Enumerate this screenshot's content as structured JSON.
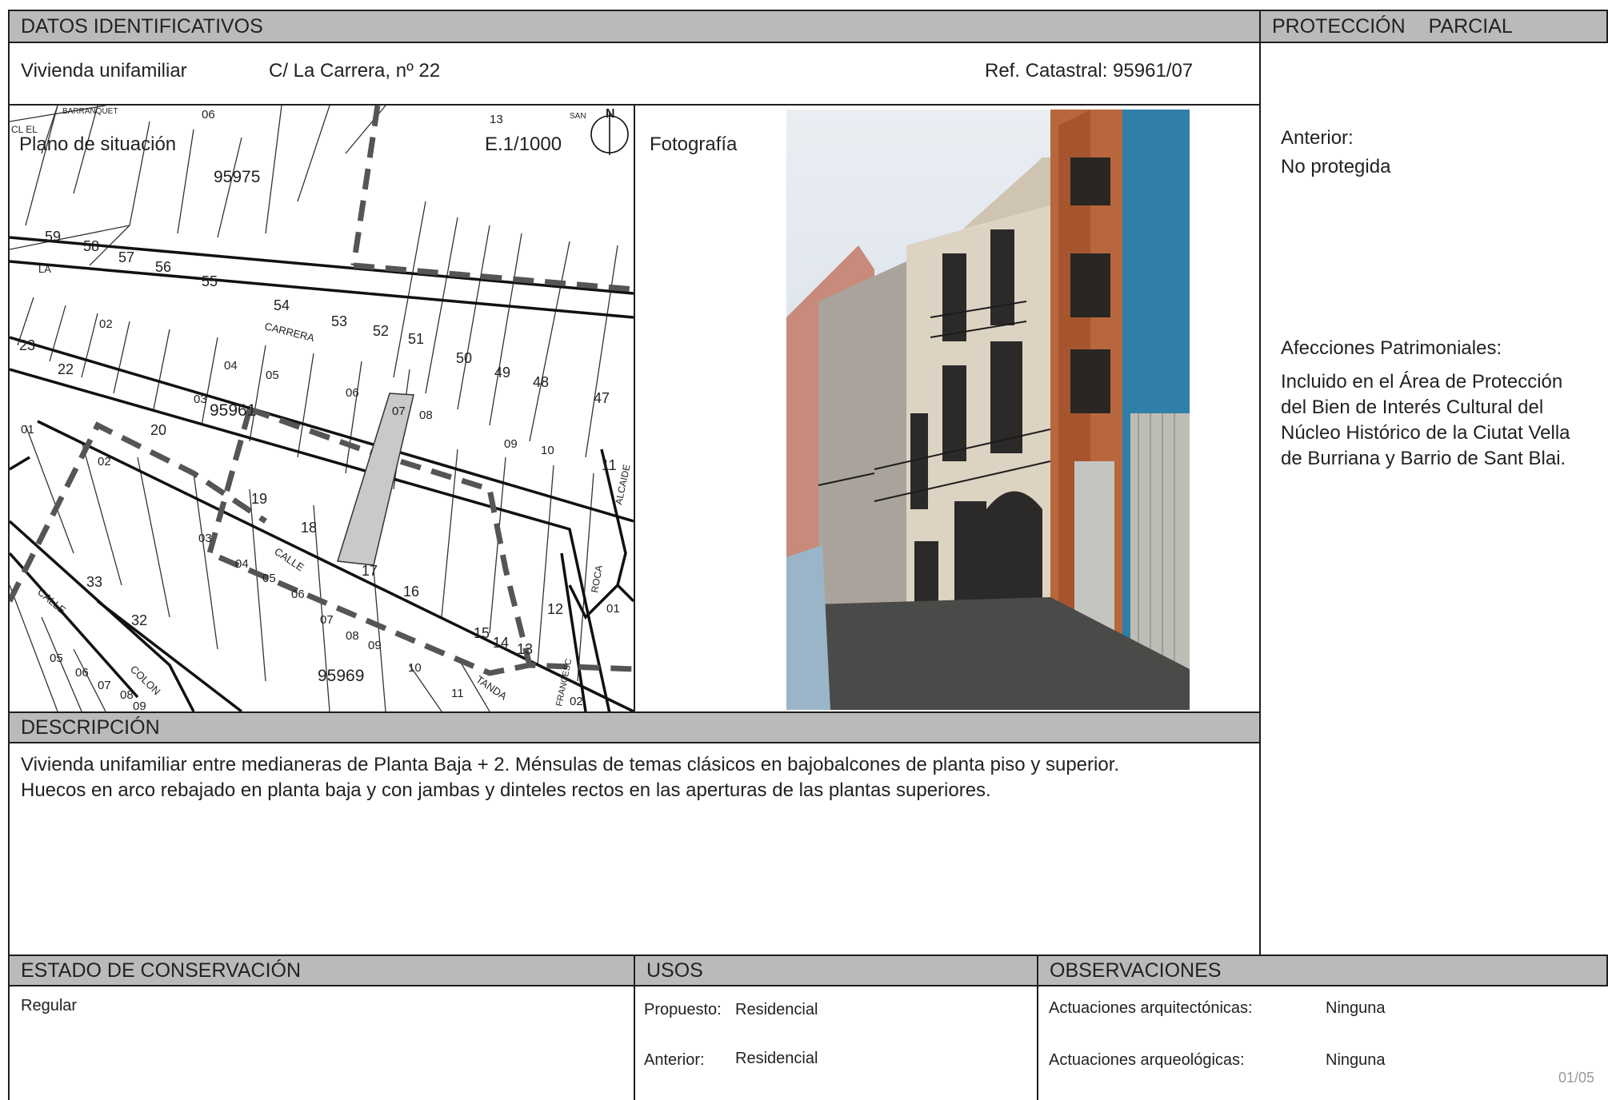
{
  "header": {
    "datos_title": "DATOS IDENTIFICATIVOS",
    "proteccion_title": "PROTECCIÓN",
    "proteccion_value": "PARCIAL"
  },
  "ident": {
    "tipo": "Vivienda unifamiliar",
    "direccion": "C/ La Carrera, nº 22",
    "ref_catastral": "Ref. Catastral: 95961/07"
  },
  "plano": {
    "label": "Plano de situación",
    "escala": "E.1/1000",
    "north": "N",
    "streets": [
      "BARRANQUET",
      "CL EL",
      "LA",
      "CARRERA",
      "CALLE",
      "LA",
      "TANDA",
      "CALLE",
      "COLON",
      "ALCAIDE",
      "ROCA",
      "FRANCESC",
      "SAN"
    ],
    "blocks": [
      "95975",
      "95961",
      "95969"
    ],
    "parcels": [
      "59",
      "58",
      "57",
      "56",
      "55",
      "54",
      "53",
      "52",
      "51",
      "50",
      "49",
      "48",
      "47",
      "23",
      "22",
      "20",
      "19",
      "18",
      "17",
      "16",
      "33",
      "32",
      "13",
      "12",
      "11",
      "10",
      "09",
      "08",
      "07",
      "06",
      "05",
      "04",
      "03",
      "02",
      "01",
      "15",
      "14"
    ]
  },
  "foto": {
    "label": "Fotografía"
  },
  "proteccion": {
    "anterior_label": "Anterior:",
    "anterior_value": "No protegida",
    "afecciones_label": "Afecciones Patrimoniales:",
    "afecciones_lines": [
      "Incluido en el Área de Protección",
      "del Bien de Interés Cultural del",
      "Núcleo Histórico de la Ciutat Vella",
      "de Burriana y Barrio de Sant Blai."
    ]
  },
  "descripcion": {
    "title": "DESCRIPCIÓN",
    "lines": [
      "Vivienda unifamiliar entre medianeras de Planta Baja + 2. Ménsulas de temas clásicos en bajobalcones de planta piso y superior.",
      "Huecos en arco rebajado en planta baja y con jambas y dinteles rectos en las aperturas de las plantas superiores."
    ]
  },
  "estado": {
    "title": "ESTADO DE CONSERVACIÓN",
    "value": "Regular"
  },
  "usos": {
    "title": "USOS",
    "propuesto_label": "Propuesto:",
    "propuesto_value": "Residencial",
    "anterior_label": "Anterior:",
    "anterior_value": "Residencial"
  },
  "observaciones": {
    "title": "OBSERVACIONES",
    "arq_label": "Actuaciones arquitectónicas:",
    "arq_value": "Ninguna",
    "arqueo_label": "Actuaciones arqueológicas:",
    "arqueo_value": "Ninguna"
  },
  "page_number": "01/05"
}
